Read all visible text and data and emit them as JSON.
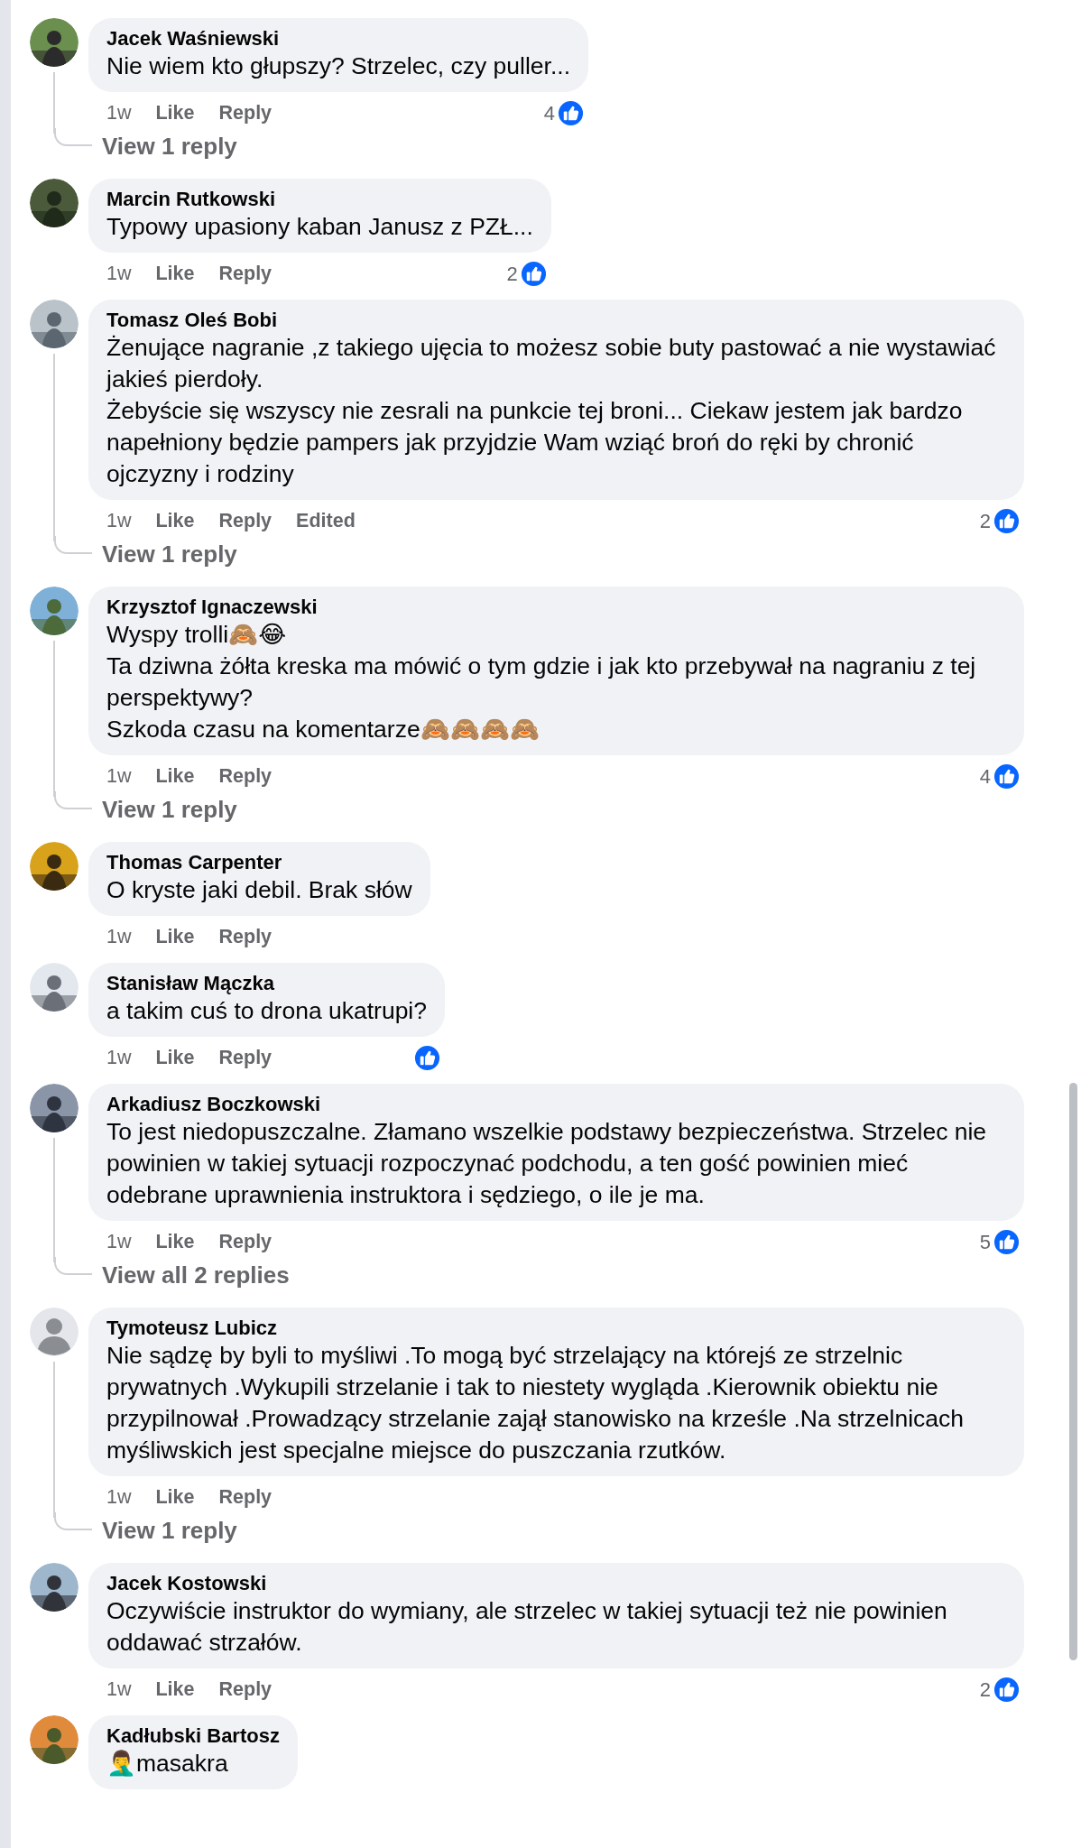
{
  "comments": [
    {
      "author": "Jacek Waśniewski",
      "text": "Nie wiem kto głupszy? Strzelec, czy puller...",
      "time": "1w",
      "like": "Like",
      "reply": "Reply",
      "reaction": true,
      "reaction_count": "4",
      "replies_link": "View 1 reply"
    },
    {
      "author": "Marcin Rutkowski",
      "text": "Typowy upasiony kaban Janusz z PZŁ...",
      "time": "1w",
      "like": "Like",
      "reply": "Reply",
      "reaction": true,
      "reaction_count": "2"
    },
    {
      "author": "Tomasz Oleś Bobi",
      "text": "Żenujące nagranie ,z takiego ujęcia to możesz sobie buty pastować a nie wystawiać jakieś pierdoły.\nŻebyście się wszyscy nie zesrali na punkcie tej broni... Ciekaw jestem jak bardzo napełniony będzie pampers jak przyjdzie Wam wziąć broń do ręki by chronić ojczyzny i rodziny",
      "time": "1w",
      "like": "Like",
      "reply": "Reply",
      "edited": "Edited",
      "reaction": true,
      "reaction_count": "2",
      "replies_link": "View 1 reply"
    },
    {
      "author": "Krzysztof Ignaczewski",
      "text": "Wyspy trolli🙈😂\nTa dziwna żółta kreska ma mówić o tym gdzie i jak kto przebywał na nagraniu z tej perspektywy?\nSzkoda czasu na komentarze🙈🙈🙈🙈",
      "time": "1w",
      "like": "Like",
      "reply": "Reply",
      "reaction": true,
      "reaction_count": "4",
      "replies_link": "View 1 reply"
    },
    {
      "author": "Thomas Carpenter",
      "text": "O kryste jaki debil. Brak słów",
      "time": "1w",
      "like": "Like",
      "reply": "Reply",
      "reaction": false
    },
    {
      "author": "Stanisław Mączka",
      "text": "a takim cuś to drona ukatrupi?",
      "time": "1w",
      "like": "Like",
      "reply": "Reply",
      "reaction": true
    },
    {
      "author": "Arkadiusz Boczkowski",
      "text": "To jest niedopuszczalne. Złamano wszelkie podstawy bezpieczeństwa. Strzelec nie powinien w takiej sytuacji rozpoczynać podchodu, a ten gość powinien mieć odebrane uprawnienia instruktora i sędziego, o ile je ma.",
      "time": "1w",
      "like": "Like",
      "reply": "Reply",
      "reaction": true,
      "reaction_count": "5",
      "replies_link": "View all 2 replies"
    },
    {
      "author": "Tymoteusz Lubicz",
      "avatar": {
        "kind": "default"
      },
      "text": "Nie sądzę by byli to myśliwi .To mogą być strzelający na którejś ze strzelnic prywatnych .Wykupili strzelanie i tak to niestety wygląda .Kierownik obiektu nie przypilnował .Prowadzący strzelanie zajął stanowisko na krześle .Na strzelnicach myśliwskich jest specjalne miejsce do puszczania rzutków.",
      "time": "1w",
      "like": "Like",
      "reply": "Reply",
      "reaction": false,
      "replies_link": "View 1 reply"
    },
    {
      "author": "Jacek Kostowski",
      "text": "Oczywiście instruktor do wymiany, ale strzelec w takiej sytuacji też nie powinien oddawać strzałów.",
      "time": "1w",
      "like": "Like",
      "reply": "Reply",
      "reaction": true,
      "reaction_count": "2"
    },
    {
      "author": "Kadłubski Bartosz",
      "text": "🤦‍♂️masakra"
    }
  ]
}
